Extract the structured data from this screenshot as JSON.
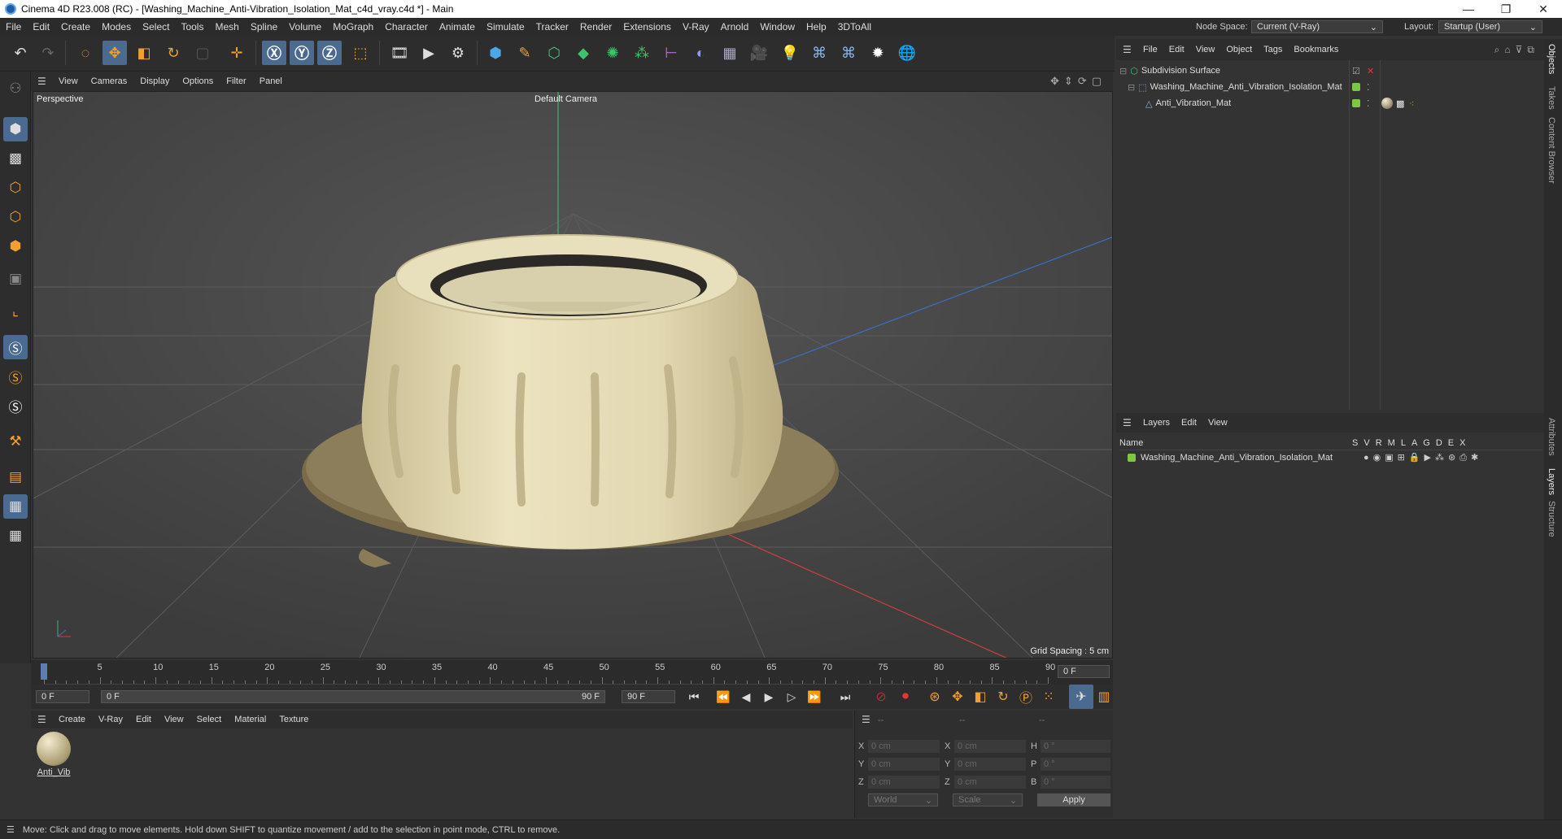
{
  "title": {
    "text": "Cinema 4D R23.008 (RC) - [Washing_Machine_Anti-Vibration_Isolation_Mat_c4d_vray.c4d *] - Main"
  },
  "menu": [
    "File",
    "Edit",
    "Create",
    "Modes",
    "Select",
    "Tools",
    "Mesh",
    "Spline",
    "Volume",
    "MoGraph",
    "Character",
    "Animate",
    "Simulate",
    "Tracker",
    "Render",
    "Extensions",
    "V-Ray",
    "Arnold",
    "Window",
    "Help",
    "3DToAll"
  ],
  "node_space": {
    "label": "Node Space:",
    "value": "Current (V-Ray)"
  },
  "layout": {
    "label": "Layout:",
    "value": "Startup (User)"
  },
  "viewport": {
    "menu": [
      "View",
      "Cameras",
      "Display",
      "Options",
      "Filter",
      "Panel"
    ],
    "name": "Perspective",
    "camera": "Default Camera",
    "grid_spacing": "Grid Spacing : 5 cm"
  },
  "timeline": {
    "ticks": [
      "0",
      "5",
      "10",
      "15",
      "20",
      "25",
      "30",
      "35",
      "40",
      "45",
      "50",
      "55",
      "60",
      "65",
      "70",
      "75",
      "80",
      "85",
      "90"
    ],
    "current_frame": "0 F"
  },
  "transport": {
    "start": "0 F",
    "range_start": "0 F",
    "range_end": "90 F",
    "end": "90 F"
  },
  "material_menu": [
    "Create",
    "V-Ray",
    "Edit",
    "View",
    "Select",
    "Material",
    "Texture"
  ],
  "material": {
    "name": "Anti_Vib"
  },
  "coords": {
    "header": [
      "--",
      "--",
      "--"
    ],
    "rows": [
      {
        "a": "X",
        "av": "0 cm",
        "b": "X",
        "bv": "0 cm",
        "c": "H",
        "cv": "0 °"
      },
      {
        "a": "Y",
        "av": "0 cm",
        "b": "Y",
        "bv": "0 cm",
        "c": "P",
        "cv": "0 °"
      },
      {
        "a": "Z",
        "av": "0 cm",
        "b": "Z",
        "bv": "0 cm",
        "c": "B",
        "cv": "0 °"
      }
    ],
    "space": "World",
    "mode": "Scale",
    "apply": "Apply"
  },
  "objects_menu": [
    "File",
    "Edit",
    "View",
    "Object",
    "Tags",
    "Bookmarks"
  ],
  "objects": [
    {
      "name": "Subdivision Surface"
    },
    {
      "name": "Washing_Machine_Anti_Vibration_Isolation_Mat"
    },
    {
      "name": "Anti_Vibration_Mat"
    }
  ],
  "layers_menu": [
    "Layers",
    "Edit",
    "View"
  ],
  "layers_header": {
    "name": "Name",
    "cols": [
      "S",
      "V",
      "R",
      "M",
      "L",
      "A",
      "G",
      "D",
      "E",
      "X"
    ]
  },
  "layers": [
    {
      "name": "Washing_Machine_Anti_Vibration_Isolation_Mat"
    }
  ],
  "right_tabs": [
    "Objects",
    "Takes",
    "Content Browser",
    "Attributes",
    "Layers",
    "Structure"
  ],
  "status": "Move: Click and drag to move elements. Hold down SHIFT to quantize movement / add to the selection in point mode, CTRL to remove.",
  "colors": {
    "accent": "#4a6b8f",
    "layer_green": "#7ac943",
    "axis_x": "#c84040",
    "axis_y": "#40b070",
    "axis_z": "#3a70c0",
    "mat_body": "#e6dcb4"
  }
}
